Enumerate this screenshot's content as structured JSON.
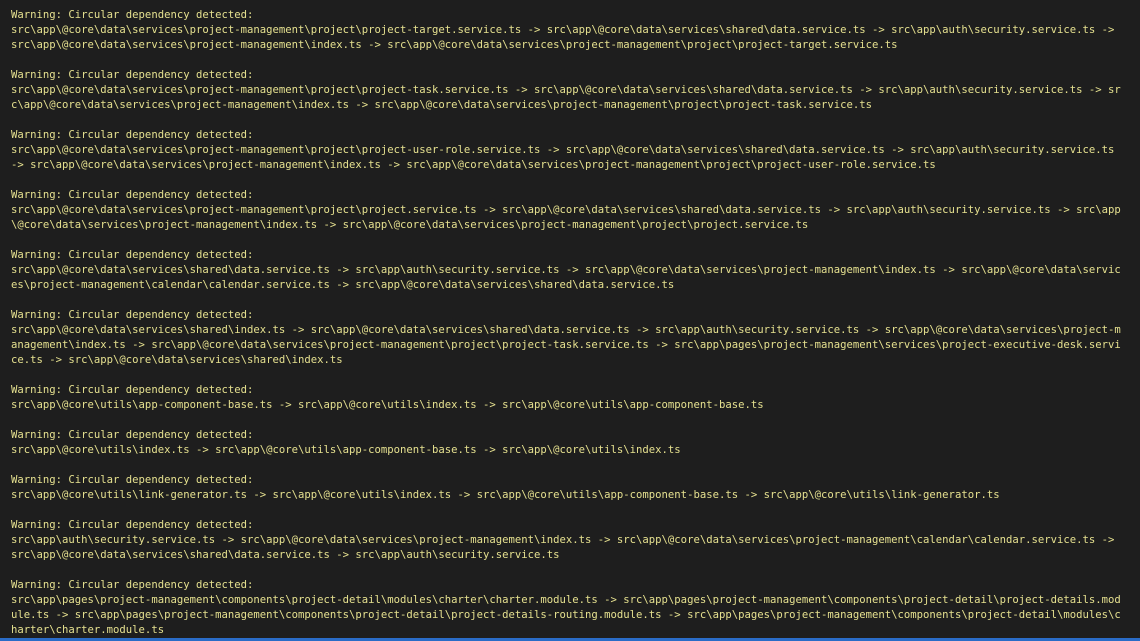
{
  "warnings": [
    {
      "title": "Warning: Circular dependency detected:",
      "lines": [
        "src\\app\\@core\\data\\services\\project-management\\project\\project-target.service.ts -> src\\app\\@core\\data\\services\\shared\\data.service.ts -> src\\app\\auth\\security.service.ts ->",
        "src\\app\\@core\\data\\services\\project-management\\index.ts -> src\\app\\@core\\data\\services\\project-management\\project\\project-target.service.ts"
      ]
    },
    {
      "title": "Warning: Circular dependency detected:",
      "lines": [
        "src\\app\\@core\\data\\services\\project-management\\project\\project-task.service.ts -> src\\app\\@core\\data\\services\\shared\\data.service.ts -> src\\app\\auth\\security.service.ts -> sr",
        "c\\app\\@core\\data\\services\\project-management\\index.ts -> src\\app\\@core\\data\\services\\project-management\\project\\project-task.service.ts"
      ]
    },
    {
      "title": "Warning: Circular dependency detected:",
      "lines": [
        "src\\app\\@core\\data\\services\\project-management\\project\\project-user-role.service.ts -> src\\app\\@core\\data\\services\\shared\\data.service.ts -> src\\app\\auth\\security.service.ts",
        "-> src\\app\\@core\\data\\services\\project-management\\index.ts -> src\\app\\@core\\data\\services\\project-management\\project\\project-user-role.service.ts"
      ]
    },
    {
      "title": "Warning: Circular dependency detected:",
      "lines": [
        "src\\app\\@core\\data\\services\\project-management\\project\\project.service.ts -> src\\app\\@core\\data\\services\\shared\\data.service.ts -> src\\app\\auth\\security.service.ts -> src\\app",
        "\\@core\\data\\services\\project-management\\index.ts -> src\\app\\@core\\data\\services\\project-management\\project\\project.service.ts"
      ]
    },
    {
      "title": "Warning: Circular dependency detected:",
      "lines": [
        "src\\app\\@core\\data\\services\\shared\\data.service.ts -> src\\app\\auth\\security.service.ts -> src\\app\\@core\\data\\services\\project-management\\index.ts -> src\\app\\@core\\data\\servic",
        "es\\project-management\\calendar\\calendar.service.ts -> src\\app\\@core\\data\\services\\shared\\data.service.ts"
      ]
    },
    {
      "title": "Warning: Circular dependency detected:",
      "lines": [
        "src\\app\\@core\\data\\services\\shared\\index.ts -> src\\app\\@core\\data\\services\\shared\\data.service.ts -> src\\app\\auth\\security.service.ts -> src\\app\\@core\\data\\services\\project-m",
        "anagement\\index.ts -> src\\app\\@core\\data\\services\\project-management\\project\\project-task.service.ts -> src\\app\\pages\\project-management\\services\\project-executive-desk.servi",
        "ce.ts -> src\\app\\@core\\data\\services\\shared\\index.ts"
      ]
    },
    {
      "title": "Warning: Circular dependency detected:",
      "lines": [
        "src\\app\\@core\\utils\\app-component-base.ts -> src\\app\\@core\\utils\\index.ts -> src\\app\\@core\\utils\\app-component-base.ts"
      ]
    },
    {
      "title": "Warning: Circular dependency detected:",
      "lines": [
        "src\\app\\@core\\utils\\index.ts -> src\\app\\@core\\utils\\app-component-base.ts -> src\\app\\@core\\utils\\index.ts"
      ]
    },
    {
      "title": "Warning: Circular dependency detected:",
      "lines": [
        "src\\app\\@core\\utils\\link-generator.ts -> src\\app\\@core\\utils\\index.ts -> src\\app\\@core\\utils\\app-component-base.ts -> src\\app\\@core\\utils\\link-generator.ts"
      ]
    },
    {
      "title": "Warning: Circular dependency detected:",
      "lines": [
        "src\\app\\auth\\security.service.ts -> src\\app\\@core\\data\\services\\project-management\\index.ts -> src\\app\\@core\\data\\services\\project-management\\calendar\\calendar.service.ts ->",
        "src\\app\\@core\\data\\services\\shared\\data.service.ts -> src\\app\\auth\\security.service.ts"
      ]
    },
    {
      "title": "Warning: Circular dependency detected:",
      "lines": [
        "src\\app\\pages\\project-management\\components\\project-detail\\modules\\charter\\charter.module.ts -> src\\app\\pages\\project-management\\components\\project-detail\\project-details.mod",
        "ule.ts -> src\\app\\pages\\project-management\\components\\project-detail\\project-details-routing.module.ts -> src\\app\\pages\\project-management\\components\\project-detail\\modules\\c",
        "harter\\charter.module.ts"
      ]
    }
  ],
  "colors": {
    "background": "#1e1e1e",
    "text": "#e5e08f",
    "accent_bar": "#2a6cc7"
  }
}
